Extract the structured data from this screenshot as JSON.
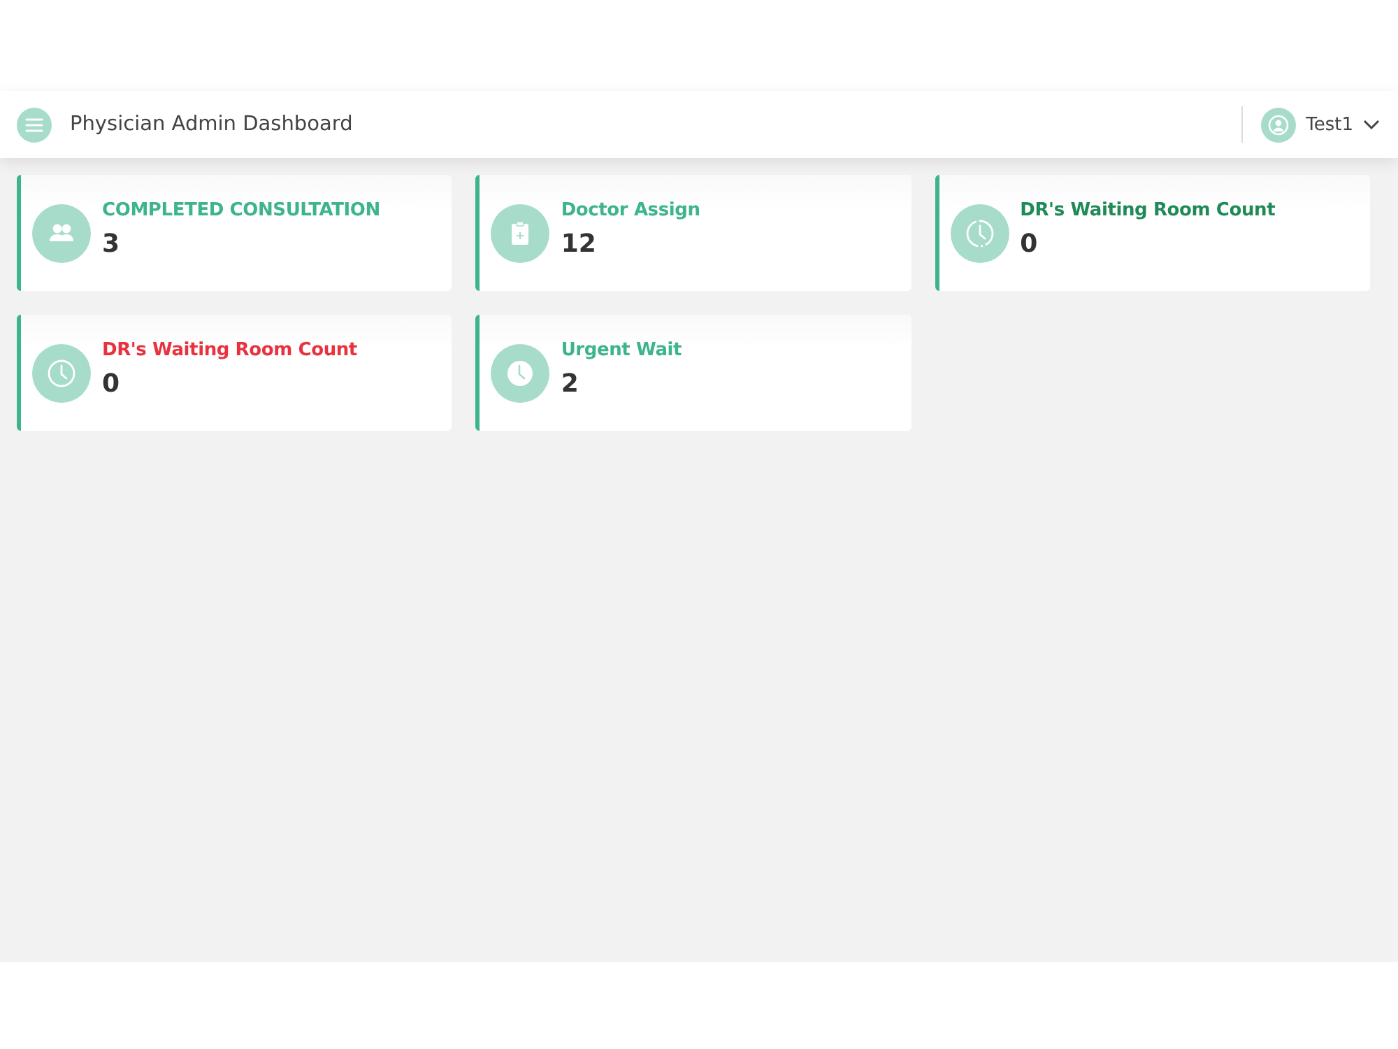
{
  "header": {
    "title": "Physician Admin Dashboard",
    "user": "Test1"
  },
  "cards": [
    {
      "title": "COMPLETED CONSULTATION",
      "value": "3",
      "color": "#3db48b"
    },
    {
      "title": "Doctor Assign",
      "value": "12",
      "color": "#3db48b"
    },
    {
      "title": "DR's Waiting Room Count",
      "value": "0",
      "color": "#1f8a57"
    },
    {
      "title": "DR's Waiting Room Count",
      "value": "0",
      "color": "#e8323f"
    },
    {
      "title": "Urgent Wait",
      "value": "2",
      "color": "#3db48b"
    }
  ]
}
